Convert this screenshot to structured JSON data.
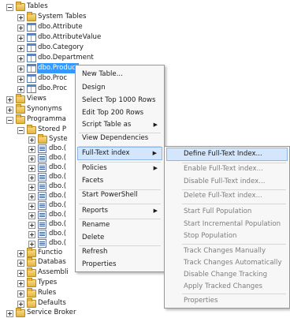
{
  "tree": {
    "tables": "Tables",
    "system_tables": "System Tables",
    "tbl_attribute": "dbo.Attribute",
    "tbl_attribute_value": "dbo.AttributeValue",
    "tbl_category": "dbo.Category",
    "tbl_department": "dbo.Department",
    "tbl_product": "dbo.Product",
    "tbl_product2": "dbo.Proc",
    "tbl_product3": "dbo.Proc",
    "views": "Views",
    "synonyms": "Synonyms",
    "programmability": "Programma",
    "stored_procs": "Stored P",
    "system_sp": "Syste",
    "sp_prefix": "dbo.(",
    "functions": "Functio",
    "database_triggers": "Databas",
    "assemblies": "Assembli",
    "types": "Types",
    "rules": "Rules",
    "defaults": "Defaults",
    "service_broker": "Service Broker"
  },
  "context_menu": {
    "new_table": "New Table...",
    "design": "Design",
    "select_top": "Select Top 1000 Rows",
    "edit_top": "Edit Top 200 Rows",
    "script_table_as": "Script Table as",
    "view_dependencies": "View Dependencies",
    "full_text_index": "Full-Text index",
    "policies": "Policies",
    "facets": "Facets",
    "start_powershell": "Start PowerShell",
    "reports": "Reports",
    "rename": "Rename",
    "delete": "Delete",
    "refresh": "Refresh",
    "properties": "Properties"
  },
  "submenu": {
    "define": "Define Full-Text Index...",
    "enable": "Enable Full-Text index...",
    "disable": "Disable Full-Text index...",
    "delete": "Delete Full-Text index...",
    "start_full": "Start Full Population",
    "start_incremental": "Start Incremental Population",
    "stop": "Stop Population",
    "track_manual": "Track Changes Manually",
    "track_auto": "Track Changes Automatically",
    "disable_tracking": "Disable Change Tracking",
    "apply_tracked": "Apply Tracked Changes",
    "properties": "Properties"
  }
}
